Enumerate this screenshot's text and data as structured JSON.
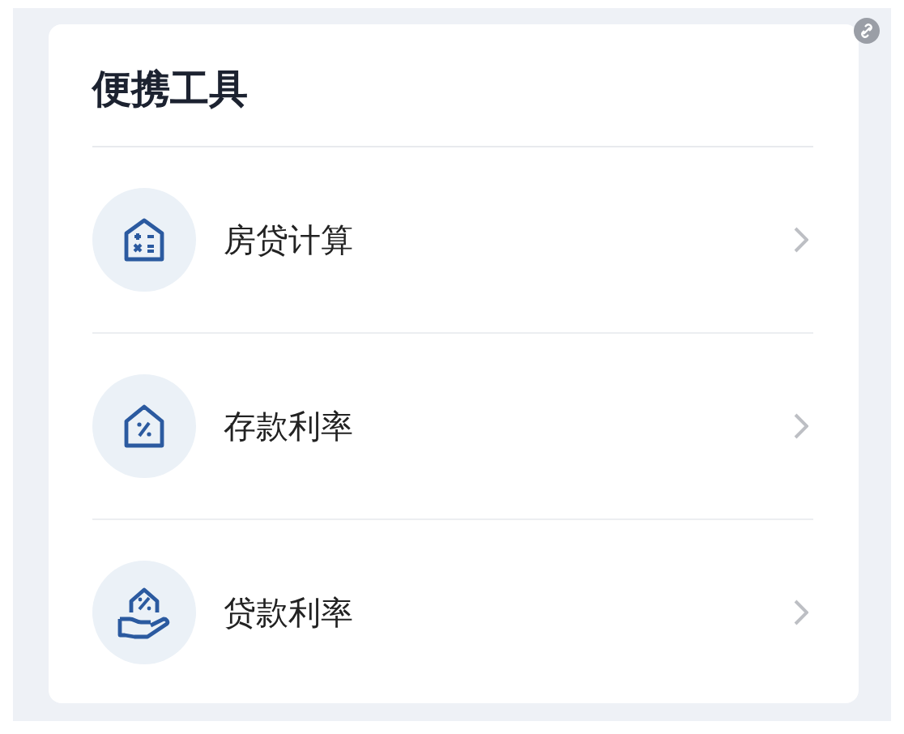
{
  "title": "便携工具",
  "tools": [
    {
      "kind": "calculator",
      "label": "房贷计算"
    },
    {
      "kind": "percent",
      "label": "存款利率"
    },
    {
      "kind": "hand",
      "label": "贷款利率"
    }
  ]
}
